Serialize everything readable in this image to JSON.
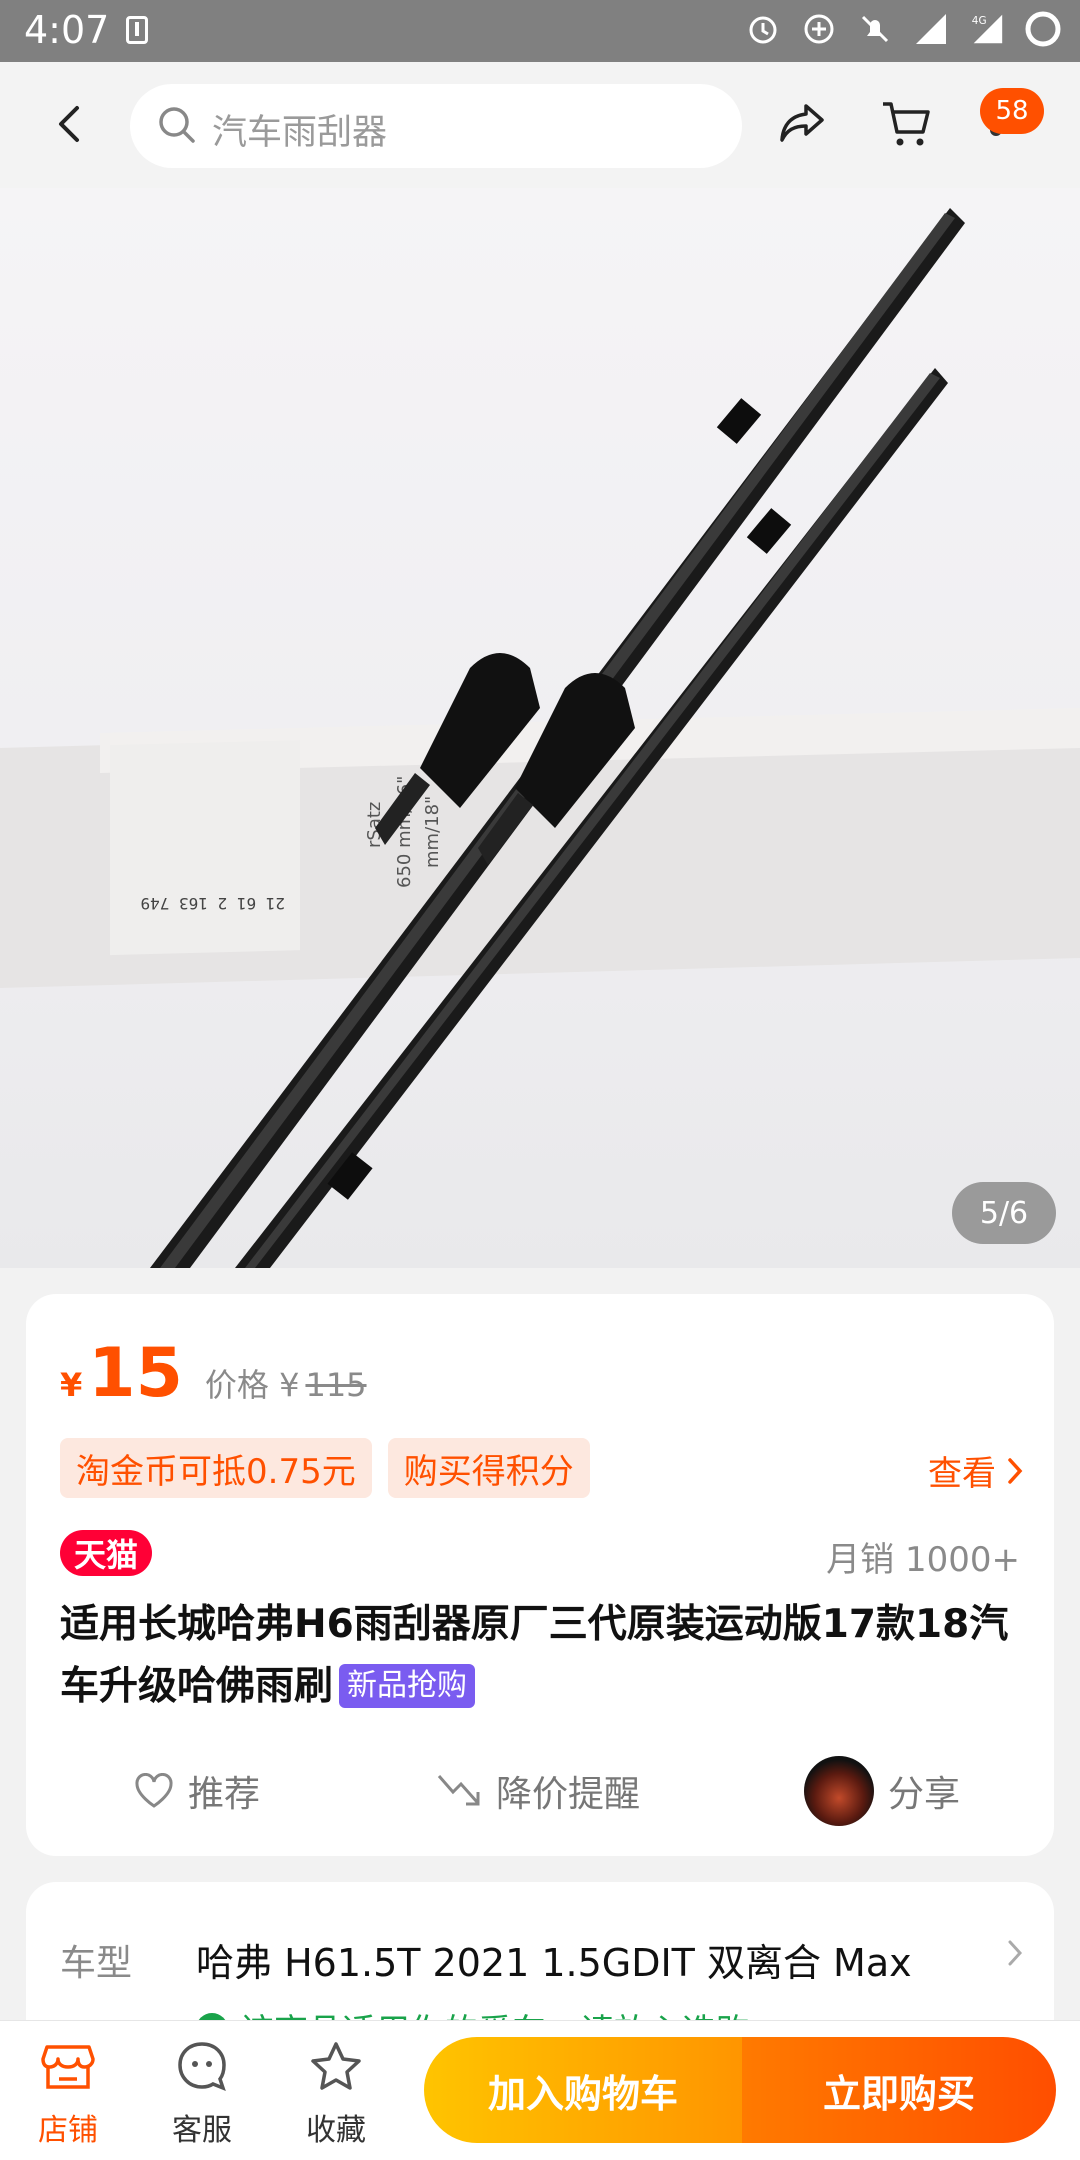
{
  "status_bar": {
    "time": "4:07",
    "network": "4G",
    "icons": [
      "download-icon",
      "alarm-icon",
      "data-saver-icon",
      "mute-icon",
      "signal-icon",
      "signal-4g-icon",
      "battery-icon"
    ]
  },
  "top_nav": {
    "search_placeholder": "汽车雨刮器",
    "cart_badge": "58",
    "icons": [
      "back-icon",
      "search-icon",
      "share-icon",
      "cart-icon"
    ]
  },
  "gallery": {
    "pager": "5/6",
    "current_index": 5,
    "total": 6,
    "image_box_label_1": "rSatz",
    "image_box_label_2": "650 mm/26\"",
    "image_box_label_3": "mm/18\"",
    "image_barcode_text": "21 61 2 163 749"
  },
  "price": {
    "currency": "¥",
    "current": "15",
    "orig_label": "价格 ¥",
    "orig_value": "115"
  },
  "promos": {
    "tag1": "淘金币可抵0.75元",
    "tag2": "购买得积分",
    "view_label": "查看"
  },
  "badge": {
    "store_type": "天猫"
  },
  "sales": "月销 1000+",
  "title": {
    "text": "适用长城哈弗H6雨刮器原厂三代原装运动版17款18汽车升级哈佛雨刷",
    "new_tag": "新品抢购"
  },
  "actions": {
    "recommend": "推荐",
    "price_alert": "降价提醒",
    "share": "分享"
  },
  "vehicle": {
    "label": "车型",
    "value": "哈弗 H61.5T 2021 1.5GDIT 双离合 Max",
    "fit_note": "该商品适用你的爱车，请放心选购"
  },
  "bottom_bar": {
    "shop": "店铺",
    "service": "客服",
    "favorite": "收藏",
    "add_to_cart": "加入购物车",
    "buy_now": "立即购买"
  },
  "colors": {
    "accent": "#ff5000",
    "tmall_red": "#ff0036",
    "new_tag_purple": "#7a5cf0",
    "cart_btn": "#ffb300",
    "buy_btn": "#ff5a00"
  }
}
